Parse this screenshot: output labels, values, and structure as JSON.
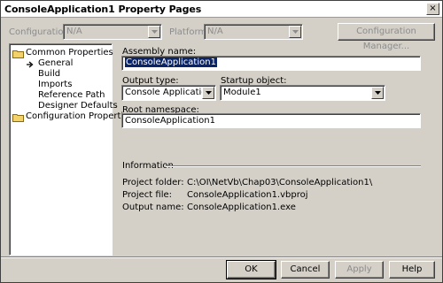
{
  "window": {
    "title": "ConsoleApplication1 Property Pages",
    "close_glyph": "×"
  },
  "toolbar": {
    "configuration_label": "Configuration:",
    "configuration_value": "N/A",
    "platform_label": "Platform:",
    "platform_value": "N/A",
    "config_manager_label": "Configuration Manager..."
  },
  "tree": {
    "common": "Common Properties",
    "general": "General",
    "build": "Build",
    "imports": "Imports",
    "reference_path": "Reference Path",
    "designer_defaults": "Designer Defaults",
    "configuration": "Configuration Properties"
  },
  "form": {
    "assembly_name_label": "Assembly name:",
    "assembly_name_value": "ConsoleApplication1",
    "output_type_label": "Output type:",
    "output_type_value": "Console Application",
    "startup_object_label": "Startup object:",
    "startup_object_value": "Module1",
    "root_namespace_label": "Root namespace:",
    "root_namespace_value": "ConsoleApplication1"
  },
  "info": {
    "header": "Information",
    "project_folder_label": "Project folder:",
    "project_folder_value": "C:\\OI\\NetVb\\Chap03\\ConsoleApplication1\\",
    "project_file_label": "Project file:",
    "project_file_value": "ConsoleApplication1.vbproj",
    "output_name_label": "Output name:",
    "output_name_value": "ConsoleApplication1.exe"
  },
  "buttons": {
    "ok": "OK",
    "cancel": "Cancel",
    "apply": "Apply",
    "help": "Help"
  },
  "icons": {
    "folder": "folder-icon",
    "arrow": "arrow-right-icon",
    "dropdown": "chevron-down-icon"
  },
  "colors": {
    "face": "#d4d0c8",
    "selection": "#0a246a",
    "folder": "#f4d26a"
  }
}
